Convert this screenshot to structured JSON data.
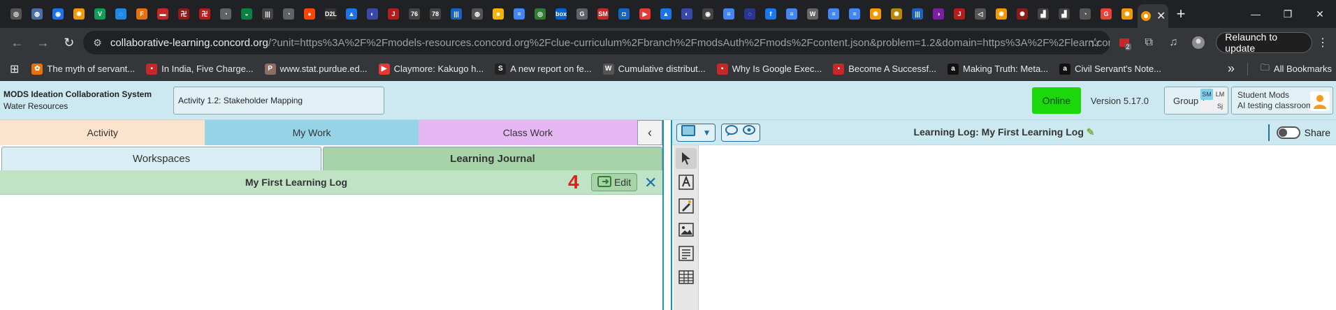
{
  "browser": {
    "favicons": [
      {
        "color": "#555",
        "glyph": "◎"
      },
      {
        "color": "#4a6fa5",
        "glyph": "◍"
      },
      {
        "color": "#1a73e8",
        "glyph": "◉"
      },
      {
        "color": "#f29900",
        "glyph": "✺"
      },
      {
        "color": "#0f9d58",
        "glyph": "V"
      },
      {
        "color": "#1e88e5",
        "glyph": "◌"
      },
      {
        "color": "#e8710a",
        "glyph": "F"
      },
      {
        "color": "#c62828",
        "glyph": "▬"
      },
      {
        "color": "#8e1a1a",
        "glyph": "卍"
      },
      {
        "color": "#b71c1c",
        "glyph": "卍"
      },
      {
        "color": "#5f6368",
        "glyph": "◔"
      },
      {
        "color": "#0b8043",
        "glyph": "◒"
      },
      {
        "color": "#444",
        "glyph": "|||"
      },
      {
        "color": "#5f6368",
        "glyph": "◔"
      },
      {
        "color": "#ff4500",
        "glyph": "●"
      },
      {
        "color": "#333",
        "glyph": "D2L"
      },
      {
        "color": "#1a73e8",
        "glyph": "▲"
      },
      {
        "color": "#3949ab",
        "glyph": "◐"
      },
      {
        "color": "#b71c1c",
        "glyph": "J"
      },
      {
        "color": "#444",
        "glyph": "76"
      },
      {
        "color": "#444",
        "glyph": "78"
      },
      {
        "color": "#1565c0",
        "glyph": "|||"
      },
      {
        "color": "#555",
        "glyph": "◍"
      },
      {
        "color": "#f4b400",
        "glyph": "■"
      },
      {
        "color": "#4285f4",
        "glyph": "≡"
      },
      {
        "color": "#2e7d32",
        "glyph": "◎"
      },
      {
        "color": "#0061d5",
        "glyph": "box"
      },
      {
        "color": "#5f6368",
        "glyph": "G"
      },
      {
        "color": "#c62828",
        "glyph": "SM"
      },
      {
        "color": "#1565c0",
        "glyph": "◘"
      },
      {
        "color": "#e53935",
        "glyph": "▶"
      },
      {
        "color": "#1a73e8",
        "glyph": "▲"
      },
      {
        "color": "#3949ab",
        "glyph": "◐"
      },
      {
        "color": "#444",
        "glyph": "◉"
      },
      {
        "color": "#4285f4",
        "glyph": "≡"
      },
      {
        "color": "#283593",
        "glyph": "◌"
      },
      {
        "color": "#1877f2",
        "glyph": "f"
      },
      {
        "color": "#4285f4",
        "glyph": "≡"
      },
      {
        "color": "#666",
        "glyph": "W"
      },
      {
        "color": "#4285f4",
        "glyph": "≡"
      },
      {
        "color": "#4285f4",
        "glyph": "≡"
      },
      {
        "color": "#f29900",
        "glyph": "✺"
      },
      {
        "color": "#b8860b",
        "glyph": "✺"
      },
      {
        "color": "#1565c0",
        "glyph": "|||"
      },
      {
        "color": "#7b1fa2",
        "glyph": "◑"
      },
      {
        "color": "#b71c1c",
        "glyph": "J"
      },
      {
        "color": "#555",
        "glyph": "◁"
      },
      {
        "color": "#f29900",
        "glyph": "✺"
      },
      {
        "color": "#8e1a1a",
        "glyph": "✺"
      },
      {
        "color": "#444",
        "glyph": "▟"
      },
      {
        "color": "#444",
        "glyph": "▟"
      },
      {
        "color": "#555",
        "glyph": "◔"
      },
      {
        "color": "#ea4335",
        "glyph": "G"
      },
      {
        "color": "#f29900",
        "glyph": "✺"
      }
    ],
    "new_tab": "+",
    "url_host": "collaborative-learning.concord.org",
    "url_rest": "/?unit=https%3A%2F%2Fmodels-resources.concord.org%2Fclue-curriculum%2Fbranch%2FmodsAuth%2Fmods%2Fcontent.json&problem=1.2&domain=https%3A%2F%2Flearn.concord.org...",
    "ext_badge": "2",
    "relaunch_label": "Relaunch to update",
    "bookmarks": [
      {
        "label": "The myth of servant...",
        "color": "#e8710a",
        "glyph": "✿"
      },
      {
        "label": "In India, Five Charge...",
        "color": "#c62828",
        "glyph": "▪"
      },
      {
        "label": "www.stat.purdue.ed...",
        "color": "#8d6e63",
        "glyph": "P"
      },
      {
        "label": "Claymore: Kakugo h...",
        "color": "#e53935",
        "glyph": "▶"
      },
      {
        "label": "A new report on fe...",
        "color": "#222",
        "glyph": "S"
      },
      {
        "label": "Cumulative distribut...",
        "color": "#555",
        "glyph": "W"
      },
      {
        "label": "Why Is Google Exec...",
        "color": "#c62828",
        "glyph": "▪"
      },
      {
        "label": "Become A Successf...",
        "color": "#c62828",
        "glyph": "▪"
      },
      {
        "label": "Making Truth: Meta...",
        "color": "#111",
        "glyph": "a"
      },
      {
        "label": "Civil Servant's Note...",
        "color": "#111",
        "glyph": "a"
      }
    ],
    "more_bookmarks": "»",
    "all_bookmarks": "All Bookmarks"
  },
  "app": {
    "name": "MODS Ideation Collaboration System",
    "subtitle": "Water Resources",
    "activity": "Activity 1.2: Stakeholder Mapping",
    "status": "Online",
    "version": "Version 5.17.0",
    "group": "Group 1",
    "group_chips": [
      {
        "text": "SM",
        "bg": "#7fd0ec"
      },
      {
        "text": "LM",
        "bg": "#f0f0f0"
      },
      {
        "text": "",
        "bg": "#f0f0f0"
      },
      {
        "text": "Sj",
        "bg": "#f0f0f0"
      }
    ],
    "user_name": "Student Mods",
    "user_class": "AI testing classroom",
    "avatar_color": "#f59a1a"
  },
  "left_panel": {
    "tabs": [
      "Activity",
      "My Work",
      "Class Work"
    ],
    "collapse": "‹",
    "subtabs": [
      "Workspaces",
      "Learning Journal"
    ],
    "log_title": "My First Learning Log",
    "annotation_number": "4",
    "edit_label": "Edit",
    "close": "✕"
  },
  "right_panel": {
    "title": "Learning Log: My First Learning Log",
    "share_label": "Share"
  },
  "colors": {
    "accent_blue": "#1f8fb6",
    "online_green": "#1bd80b",
    "annotation_red": "#e51c1c"
  }
}
